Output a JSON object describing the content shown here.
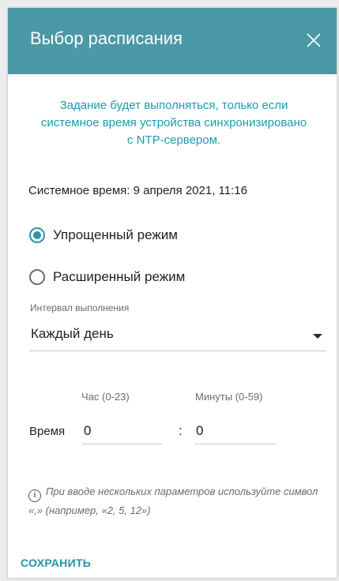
{
  "dialog": {
    "title": "Выбор расписания",
    "notice": "Задание будет выполняться, только если системное время устройства синхронизировано с NTP-сервером.",
    "system_time": "Системное время: 9 апреля 2021, 11:16"
  },
  "mode": {
    "options": [
      {
        "label": "Упрощенный режим",
        "selected": true
      },
      {
        "label": "Расширенный режим",
        "selected": false
      }
    ]
  },
  "interval": {
    "caption": "Интервал выполнения",
    "value": "Каждый день"
  },
  "time": {
    "label": "Время",
    "hour_caption": "Час (0-23)",
    "minute_caption": "Минуты (0-59)",
    "hour_value": "0",
    "minute_value": "0",
    "separator": ":"
  },
  "hint": {
    "icon": "info-icon",
    "text": "При вводе нескольких параметров используйте символ «,» (например, «2, 5, 12»)"
  },
  "footer": {
    "save_label": "СОХРАНИТЬ"
  },
  "colors": {
    "header_bg": "#4b98a7",
    "accent": "#2b95ad",
    "notice_text": "#1c9bb0"
  }
}
